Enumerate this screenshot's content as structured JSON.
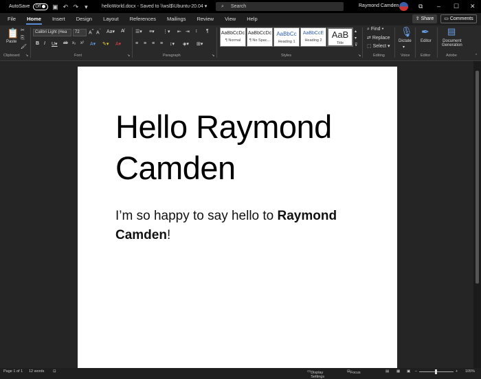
{
  "titlebar": {
    "autosave_label": "AutoSave",
    "autosave_state": "Off",
    "doc_name": "helloWorld.docx",
    "saved_status": "Saved to \\\\wsl$\\Ubuntu-20.04",
    "search_placeholder": "Search",
    "user_name": "Raymond Camden",
    "quick_icons": [
      "save-icon",
      "undo-icon",
      "redo-icon",
      "customize-icon"
    ]
  },
  "menu": {
    "tabs": [
      "File",
      "Home",
      "Insert",
      "Design",
      "Layout",
      "References",
      "Mailings",
      "Review",
      "View",
      "Help"
    ],
    "active": "Home",
    "share_label": "Share",
    "comments_label": "Comments"
  },
  "ribbon": {
    "paste_label": "Paste",
    "font_name": "Calibri Light (Hea",
    "font_size": "72",
    "styles": [
      {
        "preview": "AaBbCcDc",
        "name": "¶ Normal"
      },
      {
        "preview": "AaBbCcDc",
        "name": "¶ No Spac..."
      },
      {
        "preview": "AaBbCc",
        "name": "Heading 1"
      },
      {
        "preview": "AaBbCcE",
        "name": "Heading 2"
      },
      {
        "preview": "AaB",
        "name": "Title"
      }
    ],
    "find_label": "Find",
    "replace_label": "Replace",
    "select_label": "Select",
    "dictate_label": "Dictate",
    "editor_label": "Editor",
    "docgen_label_1": "Document",
    "docgen_label_2": "Generation",
    "groups": [
      "Clipboard",
      "Font",
      "Paragraph",
      "Styles",
      "Editing",
      "Voice",
      "Editor",
      "Adobe"
    ]
  },
  "document": {
    "heading_line1": "Hello Raymond",
    "heading_line2": "Camden",
    "para_plain": "I’m so happy to say hello to ",
    "para_bold1": "Raymond",
    "para_bold2": "Camden",
    "para_end": "!"
  },
  "statusbar": {
    "page": "Page 1 of 1",
    "words": "12 words",
    "display_settings": "Display Settings",
    "focus": "Focus",
    "zoom": "105%"
  },
  "colors": {
    "accent": "#5a8fd8",
    "titlebar_bg": "#000000",
    "ribbon_bg": "#292929",
    "canvas_bg": "#252525"
  }
}
